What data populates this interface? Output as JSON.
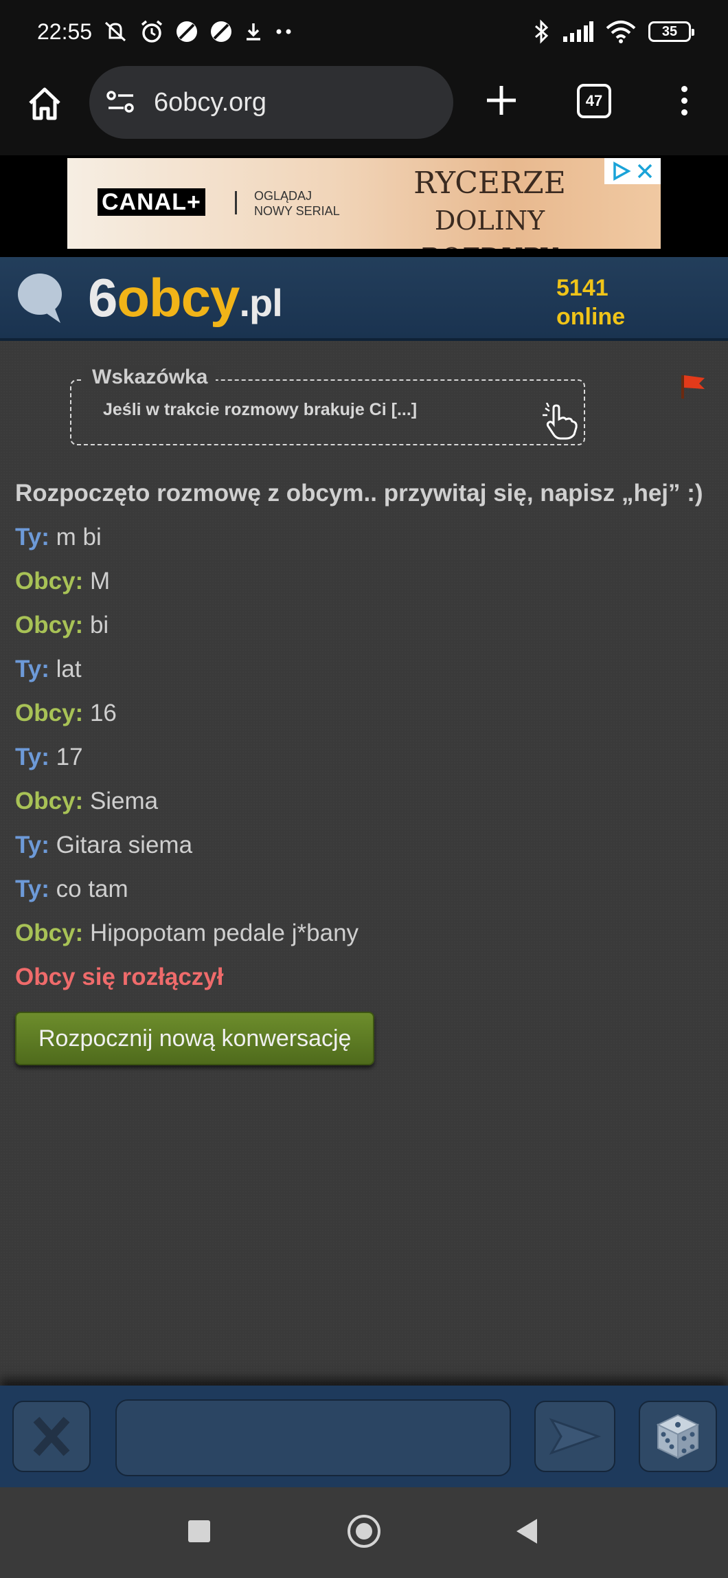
{
  "status_bar": {
    "time": "22:55",
    "battery": "35",
    "icons": [
      "mute-icon",
      "alarm-icon",
      "circle-slash-icon",
      "circle-slash-icon",
      "download-icon",
      "more-dots-icon",
      "bluetooth-icon",
      "signal-icon",
      "wifi-icon",
      "battery-icon"
    ]
  },
  "browser": {
    "url": "6obcy.org",
    "tab_count": "47"
  },
  "ad": {
    "brand": "CANAL+",
    "subtitle_line1": "OGLĄDAJ",
    "subtitle_line2": "NOWY SERIAL",
    "title_line1": "RYCERZE",
    "title_line2": "DOLINY ROZDUPY"
  },
  "site": {
    "logo_prefix": "6",
    "logo_highlight": "obcy",
    "logo_suffix": ".pl",
    "online_count": "5141",
    "online_label": "online"
  },
  "hint": {
    "legend": "Wskazówka",
    "text": "Jeśli w trakcie rozmowy brakuje Ci [...]"
  },
  "chat": {
    "start_message": "Rozpoczęto rozmowę z obcym.. przywitaj się, napisz „hej” :)",
    "messages": [
      {
        "who": "Ty:",
        "text": "m bi"
      },
      {
        "who": "Obcy:",
        "text": "M"
      },
      {
        "who": "Obcy:",
        "text": "bi"
      },
      {
        "who": "Ty:",
        "text": "lat"
      },
      {
        "who": "Obcy:",
        "text": "16"
      },
      {
        "who": "Ty:",
        "text": "17"
      },
      {
        "who": "Obcy:",
        "text": "Siema"
      },
      {
        "who": "Ty:",
        "text": "Gitara siema"
      },
      {
        "who": "Ty:",
        "text": "co tam"
      },
      {
        "who": "Obcy:",
        "text": "Hipopotam pedale j*bany"
      }
    ],
    "disconnect_message": "Obcy się rozłączył",
    "new_conversation_button": "Rozpocznij nową konwersację"
  },
  "colors": {
    "ty": "#6d9ad8",
    "obcy": "#a8c256",
    "disconnect": "#ef6b6b",
    "online": "#f0c419",
    "header_bg": "#1a3350",
    "button_green": "#5a7a23"
  }
}
